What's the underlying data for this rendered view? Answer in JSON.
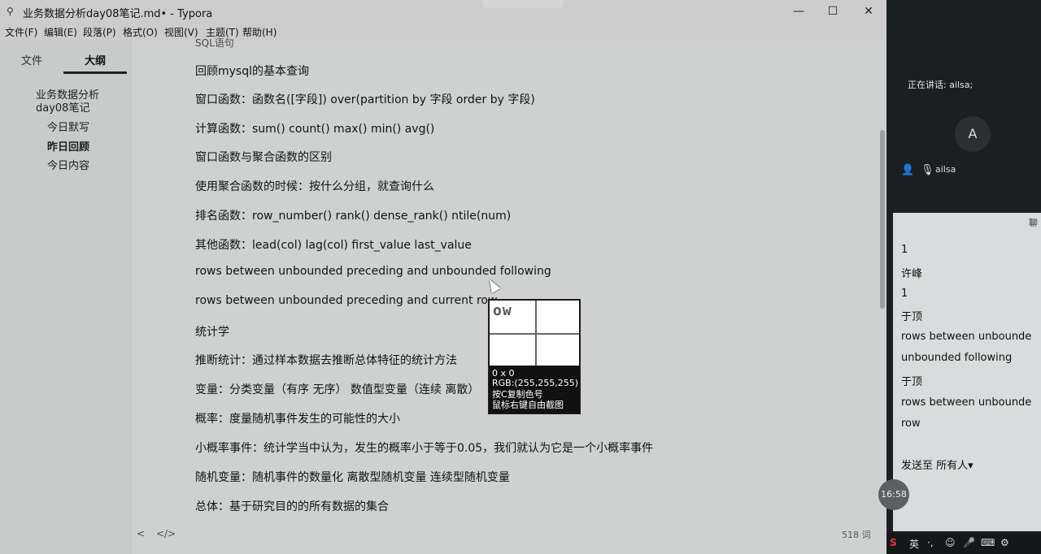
{
  "window": {
    "title": "业务数据分析day08笔记.md• - Typora",
    "controls": [
      "minimize-icon",
      "maximize-icon",
      "close-icon"
    ]
  },
  "menu": [
    "文件(F)",
    "编辑(E)",
    "段落(P)",
    "格式(O)",
    "视图(V)",
    "主题(T)",
    "帮助(H)"
  ],
  "sidebar": {
    "tabs": [
      "文件",
      "大纲"
    ],
    "outline": [
      {
        "label": "业务数据分析",
        "bold": false
      },
      {
        "label": "day08笔记",
        "bold": false
      },
      {
        "label": "今日默写",
        "bold": false
      },
      {
        "label": "昨日回顾",
        "bold": true
      },
      {
        "label": "今日内容",
        "bold": false
      }
    ]
  },
  "editor": {
    "partial_heading": "SQL语句",
    "paragraphs": [
      "回顾mysql的基本查询",
      "窗口函数：函数名([字段]) over(partition by 字段 order by 字段)",
      "计算函数：sum() count()  max() min() avg()",
      "窗口函数与聚合函数的区别",
      "使用聚合函数的时候：按什么分组，就查询什么",
      "排名函数：row_number()  rank() dense_rank() ntile(num)",
      "其他函数：lead(col)  lag(col)  first_value last_value",
      "rows between unbounded preceding  and unbounded following",
      "rows between unbounded preceding  and current row",
      "统计学",
      "推断统计：通过样本数据去推断总体特征的统计方法",
      "变量：分类变量（有序 无序）  数值型变量（连续 离散）",
      "概率：度量随机事件发生的可能性的大小",
      "小概率事件：统计学当中认为，发生的概率小于等于0.05，我们就认为它是一个小概率事件",
      "随机变量：随机事件的数量化 离散型随机变量 连续型随机变量",
      "总体：基于研究目的的所有数据的集合"
    ],
    "footer_left": "<",
    "footer_code": "</>",
    "word_count": "518 词"
  },
  "color_picker": {
    "zoom_text": "ow",
    "size": "0 x 0",
    "rgb": "RGB:(255,255,255)",
    "hint_copy": "按C复制色号",
    "hint_capture": "鼠标右键自由截图"
  },
  "meeting": {
    "speaking": "正在讲话: ailsa;",
    "avatar_letter": "A",
    "participant": "ailsa",
    "chat_header": "聊",
    "chat": [
      "1",
      "许峰",
      "1",
      "于顶",
      "rows between unbounde",
      "unbounded following",
      "于顶",
      "rows between unbounde",
      "row"
    ],
    "send_to": "发送至 所有人▾",
    "timer": "16:58"
  },
  "tray": [
    "英",
    "·,",
    "☺",
    "🎤",
    "⌨",
    "⚙"
  ]
}
